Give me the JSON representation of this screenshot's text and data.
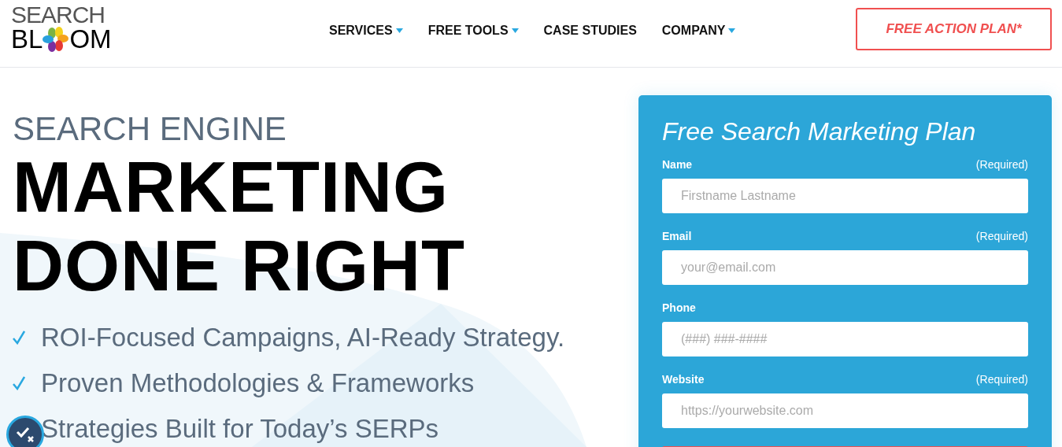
{
  "logo": {
    "top": "SEARCH",
    "bottom_left": "BL",
    "bottom_right": "OM"
  },
  "nav": [
    {
      "label": "SERVICES",
      "has_menu": true
    },
    {
      "label": "FREE TOOLS",
      "has_menu": true
    },
    {
      "label": "CASE STUDIES",
      "has_menu": false
    },
    {
      "label": "COMPANY",
      "has_menu": true
    }
  ],
  "cta": "FREE ACTION PLAN*",
  "hero": {
    "kicker": "SEARCH ENGINE",
    "headline_1": "MARKETING",
    "headline_2": "DONE RIGHT",
    "bullets": [
      "ROI-Focused Campaigns, AI-Ready Strategy.",
      "Proven Methodologies & Frameworks",
      "Strategies Built for Today’s SERPs"
    ]
  },
  "form": {
    "title": "Free Search Marketing Plan",
    "fields": [
      {
        "label": "Name",
        "required_text": "(Required)",
        "placeholder": "Firstname Lastname"
      },
      {
        "label": "Email",
        "required_text": "(Required)",
        "placeholder": "your@email.com"
      },
      {
        "label": "Phone",
        "placeholder": "(###) ###-####"
      },
      {
        "label": "Website",
        "required_text": "(Required)",
        "placeholder": "https://yourwebsite.com"
      }
    ]
  }
}
